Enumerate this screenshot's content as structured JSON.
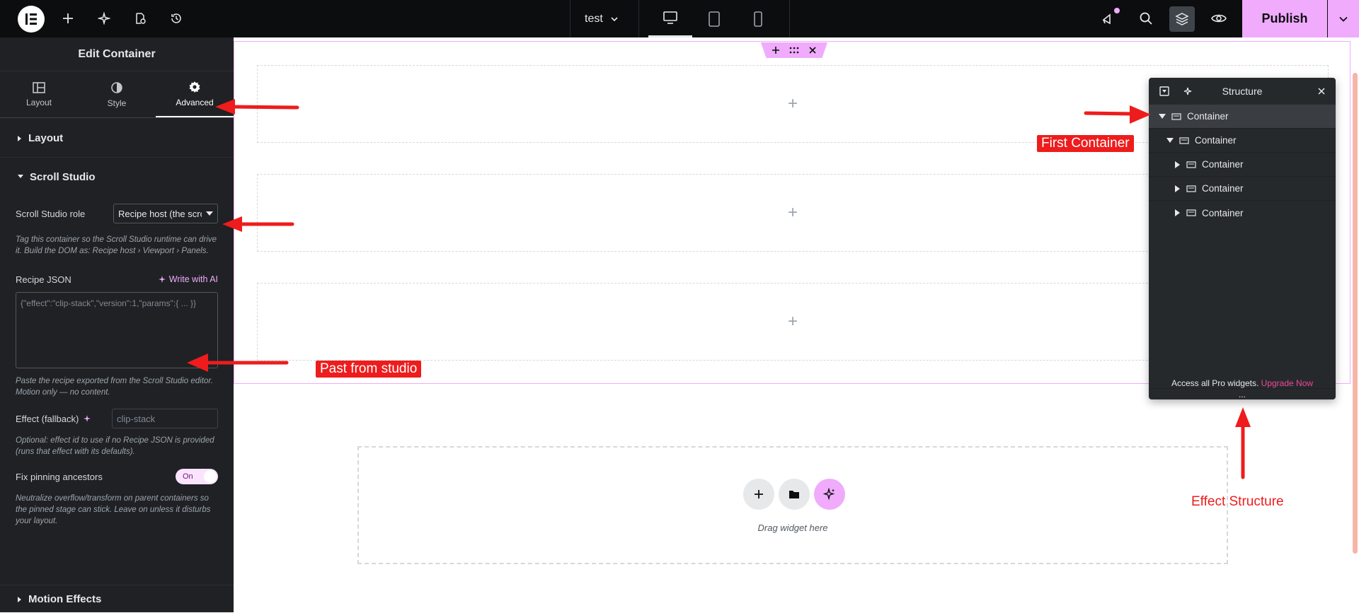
{
  "topbar": {
    "doc_title": "test",
    "publish_label": "Publish",
    "icons": [
      "elementor-logo-icon",
      "add-icon",
      "ai-sparkle-icon",
      "page-settings-icon",
      "history-icon",
      "desktop-icon",
      "tablet-icon",
      "mobile-icon",
      "notifications-icon",
      "search-icon",
      "structure-layers-icon",
      "preview-eye-icon",
      "chevron-down-icon"
    ],
    "accent_color": "#f0abfc"
  },
  "panel": {
    "title": "Edit Container",
    "tabs": [
      {
        "label": "Layout",
        "icon": "layout-icon"
      },
      {
        "label": "Style",
        "icon": "style-icon"
      },
      {
        "label": "Advanced",
        "icon": "gear-icon"
      }
    ],
    "sections": {
      "layout": "Layout",
      "scroll_studio": "Scroll Studio",
      "motion_effects": "Motion Effects"
    },
    "scroll_role": {
      "label": "Scroll Studio role",
      "value": "Recipe host (the scroll",
      "help": "Tag this container so the Scroll Studio runtime can drive it. Build the DOM as: Recipe host › Viewport › Panels."
    },
    "recipe_json": {
      "label": "Recipe JSON",
      "ai_label": "Write with AI",
      "placeholder": "{\"effect\":\"clip-stack\",\"version\":1,\"params\":{ ... }}",
      "help": "Paste the recipe exported from the Scroll Studio editor. Motion only — no content."
    },
    "effect_fallback": {
      "label": "Effect (fallback)",
      "placeholder": "clip-stack",
      "help": "Optional: effect id to use if no Recipe JSON is provided (runs that effect with its defaults)."
    },
    "fix_pinning": {
      "label": "Fix pinning ancestors",
      "toggle": "On",
      "help": "Neutralize overflow/transform on parent containers so the pinned stage can stick. Leave on unless it disturbs your layout."
    }
  },
  "canvas": {
    "plus": "+",
    "drop_text": "Drag widget here"
  },
  "structure": {
    "title": "Structure",
    "items": [
      {
        "label": "Container",
        "depth": 0,
        "expanded": true
      },
      {
        "label": "Container",
        "depth": 1,
        "expanded": true
      },
      {
        "label": "Container",
        "depth": 2,
        "expanded": false
      },
      {
        "label": "Container",
        "depth": 2,
        "expanded": false
      },
      {
        "label": "Container",
        "depth": 2,
        "expanded": false
      }
    ],
    "footer_text": "Access all Pro widgets.",
    "footer_link": "Upgrade Now",
    "grip": "..."
  },
  "annotations": {
    "first_container": "First Container",
    "past_from_studio": "Past from studio",
    "effect_structure": "Effect Structure",
    "color": "#ee1c1c"
  }
}
